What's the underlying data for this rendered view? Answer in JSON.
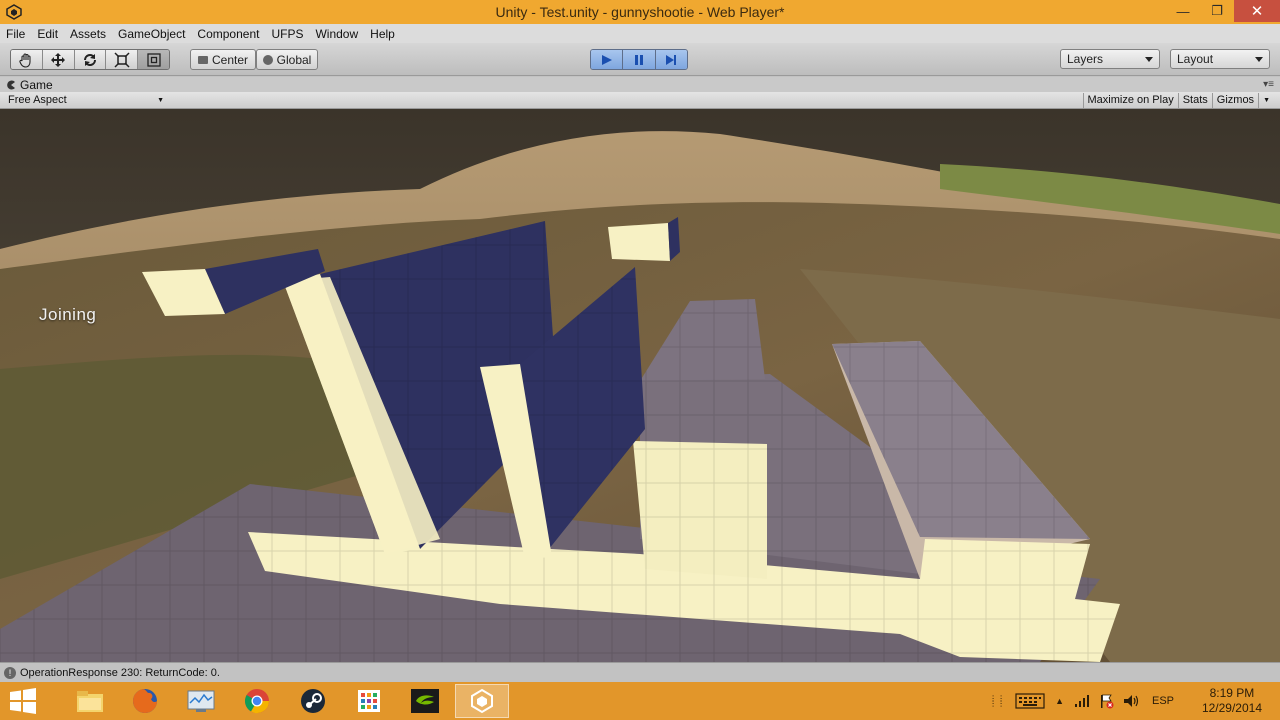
{
  "window": {
    "title": "Unity - Test.unity - gunnyshootie - Web Player*",
    "minimize": "—",
    "maximize": "❐",
    "close": "✕"
  },
  "menu": [
    "File",
    "Edit",
    "Assets",
    "GameObject",
    "Component",
    "UFPS",
    "Window",
    "Help"
  ],
  "toolbar": {
    "pivot_label": "Center",
    "space_label": "Global",
    "layers_label": "Layers",
    "layout_label": "Layout"
  },
  "panel": {
    "tab_label": "Game",
    "aspect_label": "Free Aspect",
    "maximize_label": "Maximize on Play",
    "stats_label": "Stats",
    "gizmos_label": "Gizmos"
  },
  "game": {
    "overlay_text": "Joining"
  },
  "status": {
    "message": "OperationResponse 230: ReturnCode: 0."
  },
  "taskbar": {
    "language": "ESP",
    "time": "8:19 PM",
    "date": "12/29/2014"
  },
  "colors": {
    "titlebar": "#f0a830",
    "taskbar": "#e2962a",
    "play_active": "#7ea6df",
    "wall_dark": "#2e3160",
    "wall_light": "#f7f1c4",
    "floor": "#6e6470"
  }
}
